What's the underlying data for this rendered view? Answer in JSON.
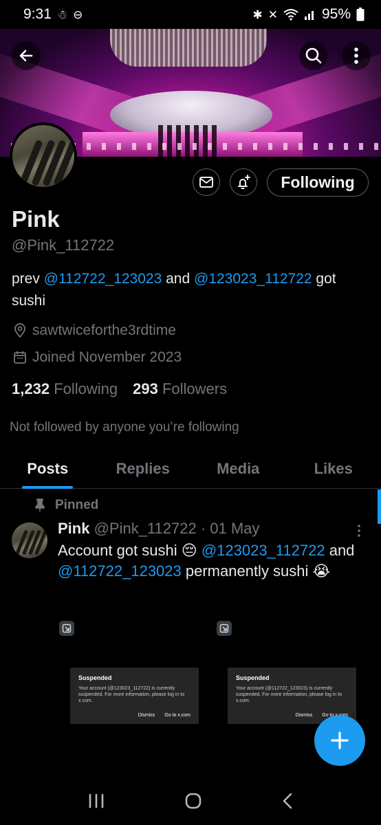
{
  "status_bar": {
    "time": "9:31",
    "battery": "95%"
  },
  "profile": {
    "name": "Pink",
    "handle": "@Pink_112722",
    "bio_prefix": "prev ",
    "bio_link1": "@112722_123023",
    "bio_mid": " and ",
    "bio_link2": "@123023_112722",
    "bio_suffix": " got sushi",
    "location": "sawtwiceforthe3rdtime",
    "joined": "Joined November 2023",
    "following_count": "1,232",
    "following_label": "Following",
    "followers_count": "293",
    "followers_label": "Followers",
    "follow_button": "Following",
    "not_followed": "Not followed by anyone you’re following"
  },
  "tabs": [
    {
      "label": "Posts",
      "active": true
    },
    {
      "label": "Replies"
    },
    {
      "label": "Media"
    },
    {
      "label": "Likes"
    }
  ],
  "post": {
    "pinned_label": "Pinned",
    "author": "Pink",
    "handle_time": " @Pink_112722 · 01 May",
    "text1": "Account got sushi 😔 ",
    "link1": "@123023_112722",
    "text2": " and ",
    "link2": "@112722_123023",
    "text3": " permanently sushi 😭"
  },
  "suspended_cards": [
    {
      "title": "Suspended",
      "body": "Your account (@123023_112722) is currently suspended. For more information, please log in to x.com.",
      "dismiss": "Dismiss",
      "goto": "Go to x.com"
    },
    {
      "title": "Suspended",
      "body": "Your account (@112722_123023) is currently suspended. For more information, please log in to x.com.",
      "dismiss": "Dismiss",
      "goto": "Go to x.com"
    }
  ],
  "colors": {
    "accent": "#1d9bf0",
    "muted": "#71767b",
    "background": "#000000"
  },
  "icons": [
    "back-arrow-icon",
    "search-icon",
    "more-vertical-icon",
    "mail-icon",
    "bell-plus-icon",
    "location-pin-icon",
    "calendar-icon",
    "pin-icon",
    "plus-icon"
  ]
}
